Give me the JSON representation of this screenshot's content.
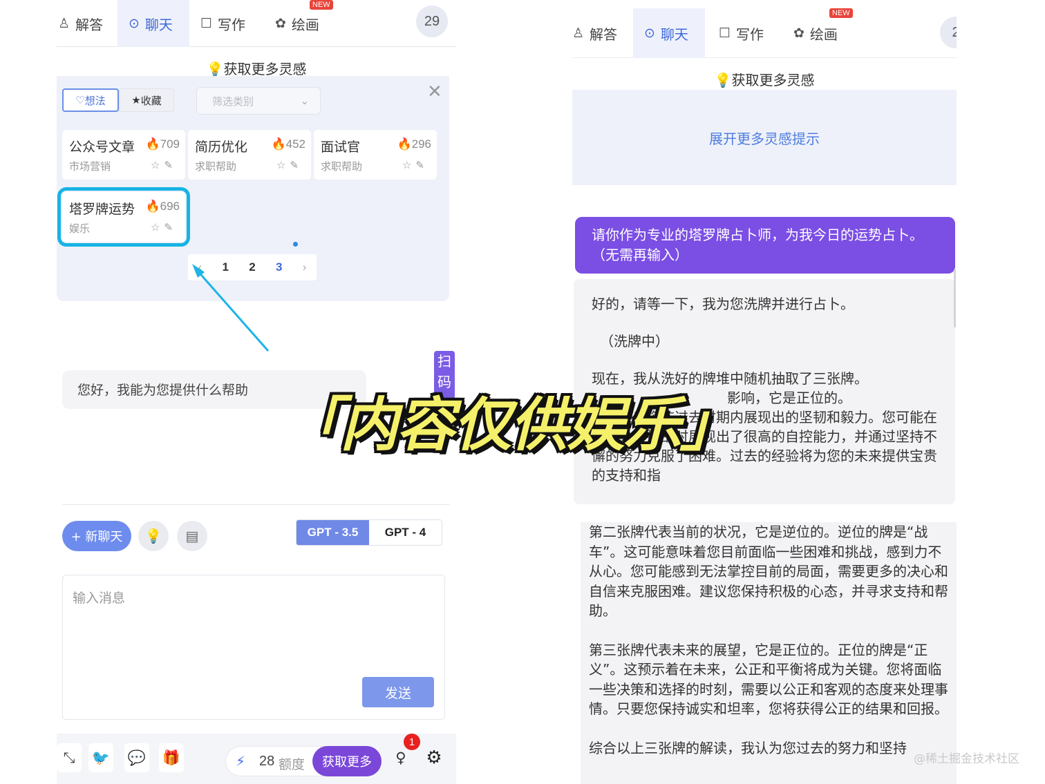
{
  "left": {
    "nav": {
      "tabs": [
        {
          "icon": "answer-icon",
          "label": "解答"
        },
        {
          "icon": "chat-icon",
          "label": "聊天"
        },
        {
          "icon": "write-icon",
          "label": "写作"
        },
        {
          "icon": "paint-icon",
          "label": "绘画"
        }
      ],
      "active_tab": "聊天",
      "new_badge": "NEW",
      "count": "29"
    },
    "inspiration_title": "获取更多灵感",
    "prompt_panel": {
      "toggle_idea": "想法",
      "toggle_fav": "收藏",
      "filter_placeholder": "筛选类别",
      "close": "✕",
      "cards": [
        {
          "title": "公众号文章",
          "count": "709",
          "category": "市场营销"
        },
        {
          "title": "简历优化",
          "count": "452",
          "category": "求职帮助"
        },
        {
          "title": "面试官",
          "count": "296",
          "category": "求职帮助"
        },
        {
          "title": "塔罗牌运势",
          "count": "696",
          "category": "娱乐"
        }
      ],
      "pagination": {
        "prev": "‹",
        "pages": [
          "1",
          "2",
          "3"
        ],
        "current": "3",
        "next": "›"
      }
    },
    "greeting": "您好，我能为您提供什么帮助",
    "scan_tag": "扫码",
    "new_chat_label": "+ 新聊天",
    "models": [
      "GPT - 3.5",
      "GPT - 4"
    ],
    "active_model": "GPT - 3.5",
    "input_placeholder": "输入消息",
    "send_label": "发送",
    "footer": {
      "quota_count": "28",
      "quota_label": "额度",
      "get_more_label": "获取更多",
      "notification_count": "1"
    }
  },
  "right": {
    "nav": {
      "tabs": [
        {
          "icon": "answer-icon",
          "label": "解答"
        },
        {
          "icon": "chat-icon",
          "label": "聊天"
        },
        {
          "icon": "write-icon",
          "label": "写作"
        },
        {
          "icon": "paint-icon",
          "label": "绘画"
        }
      ],
      "active_tab": "聊天",
      "new_badge": "NEW",
      "count_partial": "2"
    },
    "inspiration_title": "获取更多灵感",
    "expand_prompts": "展开更多灵感提示",
    "user_message": "请你作为专业的塔罗牌占卜师，为我今日的运势占卜。（无需再输入）",
    "ai_reply_1": {
      "line1": "好的，请等一下，我为您洗牌并进行占卜。",
      "line2": "（洗牌中）",
      "line3": "现在，我从洗好的牌堆中随机抽取了三张牌。",
      "line4_partial": "影响，它是正位的。",
      "line5": "它代表着您在过去时期内展现出的坚韧和毅力。您可能在面对一些挑战时展现出了很高的自控能力，并通过坚持不懈的努力克服了困难。过去的经验将为您的未来提供宝贵的支持和指"
    },
    "ai_reply_2": {
      "para1": "第二张牌代表当前的状况，它是逆位的。逆位的牌是“战车”。这可能意味着您目前面临一些困难和挑战，感到力不从心。您可能感到无法掌控目前的局面，需要更多的决心和自信来克服困难。建议您保持积极的心态，并寻求支持和帮助。",
      "para2": "第三张牌代表未来的展望，它是正位的。正位的牌是“正义”。这预示着在未来，公正和平衡将成为关键。您将面临一些决策和选择的时刻，需要以公正和客观的态度来处理事情。只要您保持诚实和坦率，您将获得公正的结果和回报。",
      "para3": "综合以上三张牌的解读，我认为您过去的努力和坚持"
    }
  },
  "overlay_caption": "「内容仅供娱乐」",
  "watermark": "@稀土掘金技术社区",
  "colors": {
    "accent_blue": "#3f68d9",
    "user_bubble_purple": "#7b4ee4",
    "highlight_cyan": "#17b3e4",
    "caption_yellow": "#f5f06a"
  }
}
